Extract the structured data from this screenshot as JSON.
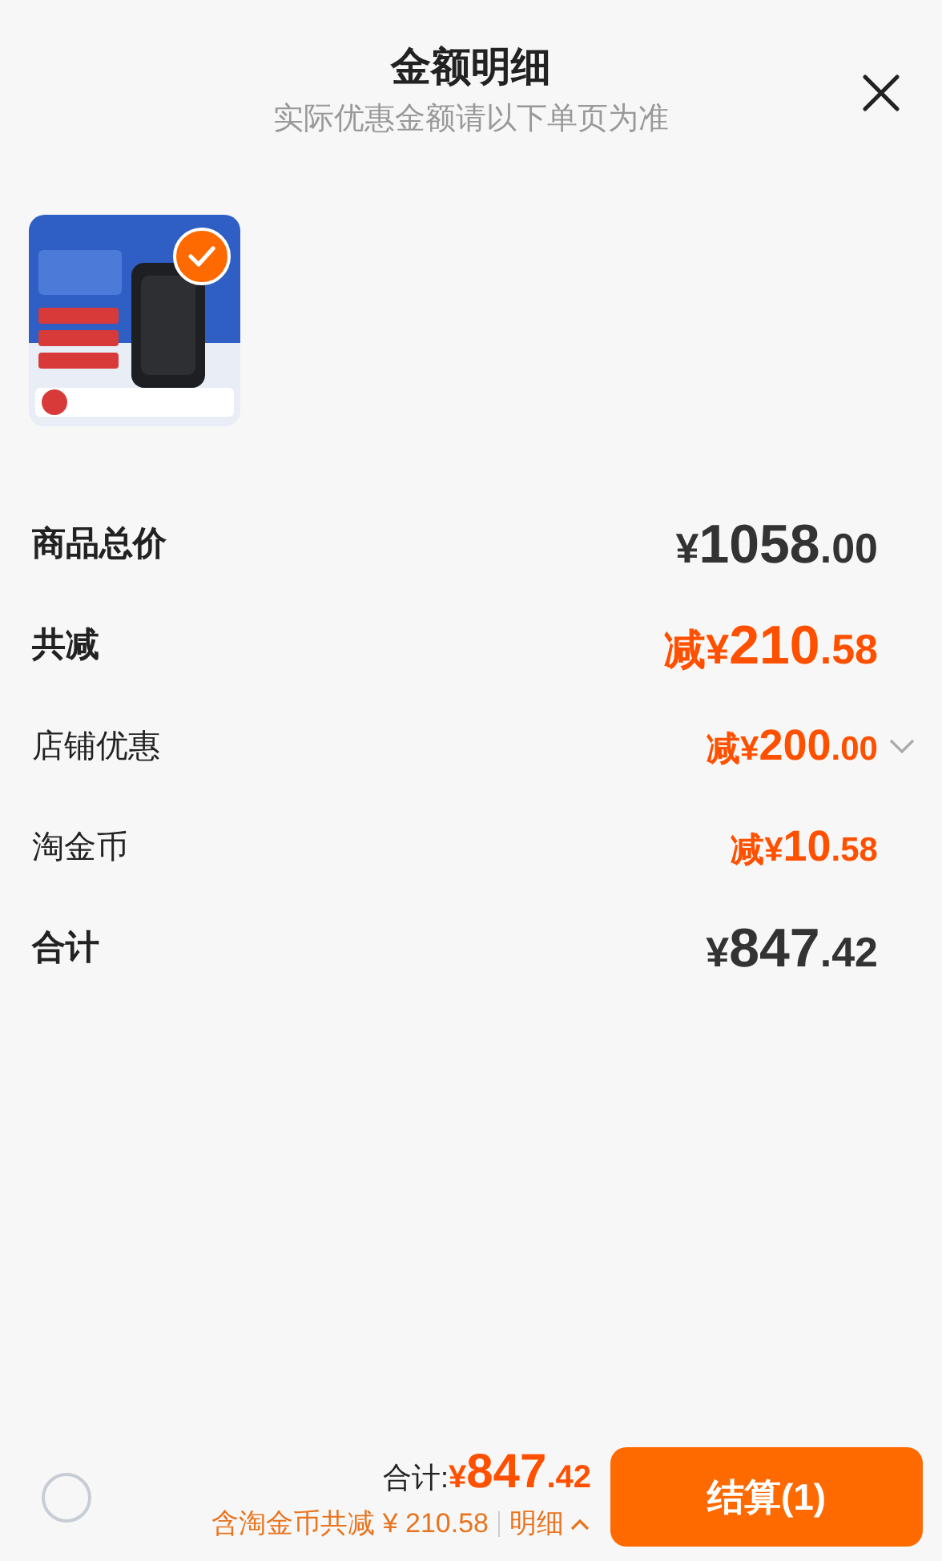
{
  "header": {
    "title": "金额明细",
    "subtitle": "实际优惠金额请以下单页为准"
  },
  "product": {
    "selected": true
  },
  "rows": [
    {
      "label": "商品总价",
      "kind": "plain",
      "emphasis": true,
      "color": "#333333",
      "amount": "¥1058.00"
    },
    {
      "label": "共减",
      "kind": "plain",
      "emphasis": true,
      "color": "#ff5000",
      "amount": "减¥210.58"
    },
    {
      "label": "店铺优惠",
      "kind": "expandable",
      "expanded": false,
      "emphasis": false,
      "color": "#ff5000",
      "amount": "减¥200.00"
    },
    {
      "label": "淘金币",
      "kind": "plain",
      "emphasis": false,
      "color": "#ff5000",
      "amount": "减¥10.58"
    },
    {
      "label": "合计",
      "kind": "plain",
      "emphasis": true,
      "color": "#333333",
      "amount": "¥847.42"
    }
  ],
  "footer": {
    "select_all": {
      "checked": false
    },
    "total_label": "合计:",
    "total_amount": "¥847.42",
    "savings_note": "含淘金币共减 ¥ 210.58",
    "details_link": {
      "label": "明细",
      "expanded": true
    },
    "checkout_button": "结算(1)"
  }
}
